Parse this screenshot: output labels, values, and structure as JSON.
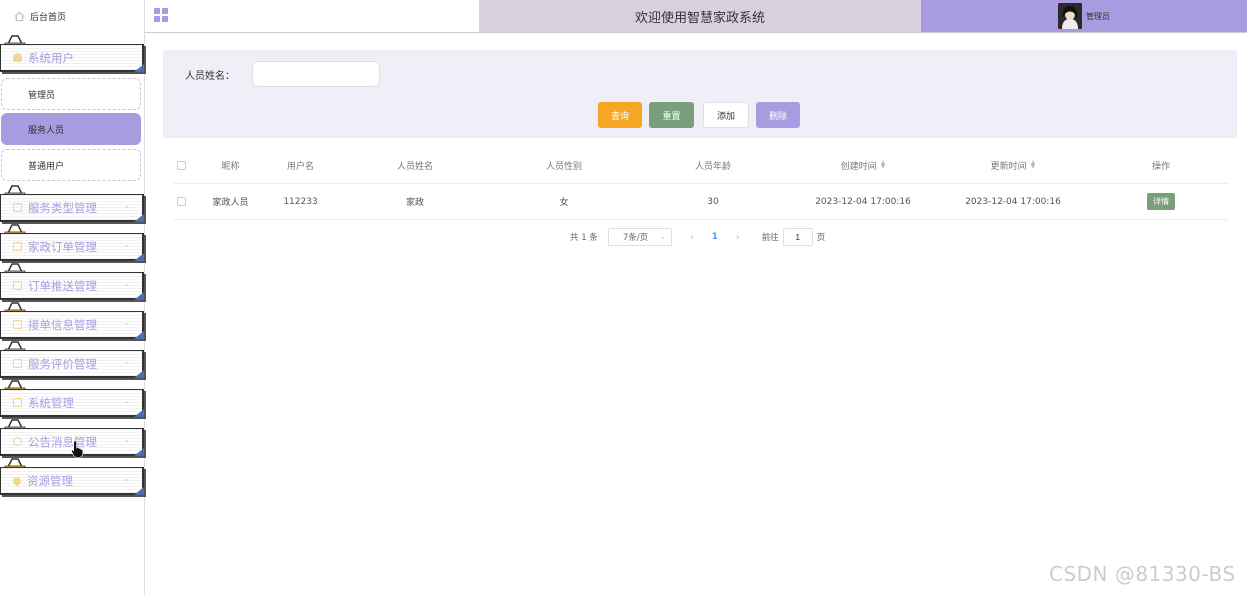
{
  "header": {
    "home_label": "后台首页",
    "welcome_text": "欢迎使用智慧家政系统",
    "user_label": "管理员"
  },
  "sidebar": {
    "groups": [
      {
        "label": "系统用户",
        "icon": "user-icon"
      },
      {
        "label": "服务类型管理",
        "icon": "doc-icon"
      },
      {
        "label": "家政订单管理",
        "icon": "doc-icon"
      },
      {
        "label": "订单推送管理",
        "icon": "doc-icon"
      },
      {
        "label": "接单信息管理",
        "icon": "doc-icon"
      },
      {
        "label": "服务评价管理",
        "icon": "doc-icon"
      },
      {
        "label": "系统管理",
        "icon": "settings-icon"
      },
      {
        "label": "公告消息管理",
        "icon": "info-icon"
      },
      {
        "label": "资源管理",
        "icon": "location-icon"
      }
    ],
    "sub_items": [
      {
        "label": "管理员"
      },
      {
        "label": "服务人员"
      },
      {
        "label": "普通用户"
      }
    ]
  },
  "search": {
    "label": "人员姓名：",
    "value": "",
    "placeholder": ""
  },
  "buttons": {
    "query": "查询",
    "reset": "重置",
    "add": "添加",
    "delete": "删除"
  },
  "table": {
    "columns": [
      "昵称",
      "用户名",
      "人员姓名",
      "人员性别",
      "人员年龄",
      "创建时间",
      "更新时间",
      "操作"
    ],
    "rows": [
      {
        "nickname": "家政人员",
        "username": "112233",
        "name": "家政",
        "gender": "女",
        "age": "30",
        "created": "2023-12-04 17:00:16",
        "updated": "2023-12-04 17:00:16",
        "action": "详情"
      }
    ]
  },
  "pagination": {
    "total": "共 1 条",
    "page_size": "7条/页",
    "current_page": "1",
    "goto_label": "前往",
    "goto_value": "1",
    "page_unit": "页"
  },
  "watermark": "CSDN @81330-BS",
  "colors": {
    "accent": "#a99bdf",
    "query": "#f5a623",
    "reset": "#79a07b",
    "welcome_bg": "#d8d0df",
    "panel_bg": "#f0eef7"
  }
}
